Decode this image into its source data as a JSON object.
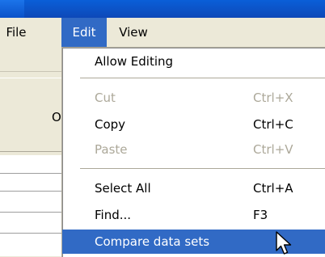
{
  "menubar": {
    "file_label": "File",
    "edit_label": "Edit",
    "view_label": "View"
  },
  "background": {
    "button_label": "O"
  },
  "edit_menu": {
    "allow_editing": {
      "label": "Allow Editing"
    },
    "cut": {
      "label": "Cut",
      "shortcut": "Ctrl+X",
      "enabled": false
    },
    "copy": {
      "label": "Copy",
      "shortcut": "Ctrl+C",
      "enabled": true
    },
    "paste": {
      "label": "Paste",
      "shortcut": "Ctrl+V",
      "enabled": false
    },
    "select_all": {
      "label": "Select All",
      "shortcut": "Ctrl+A",
      "enabled": true
    },
    "find": {
      "label": "Find...",
      "shortcut": "F3",
      "enabled": true
    },
    "compare": {
      "label": "Compare data sets",
      "highlighted": true
    }
  },
  "colors": {
    "highlight": "#316ac5",
    "disabled_text": "#aca899",
    "menu_bg": "#ece9d8"
  }
}
